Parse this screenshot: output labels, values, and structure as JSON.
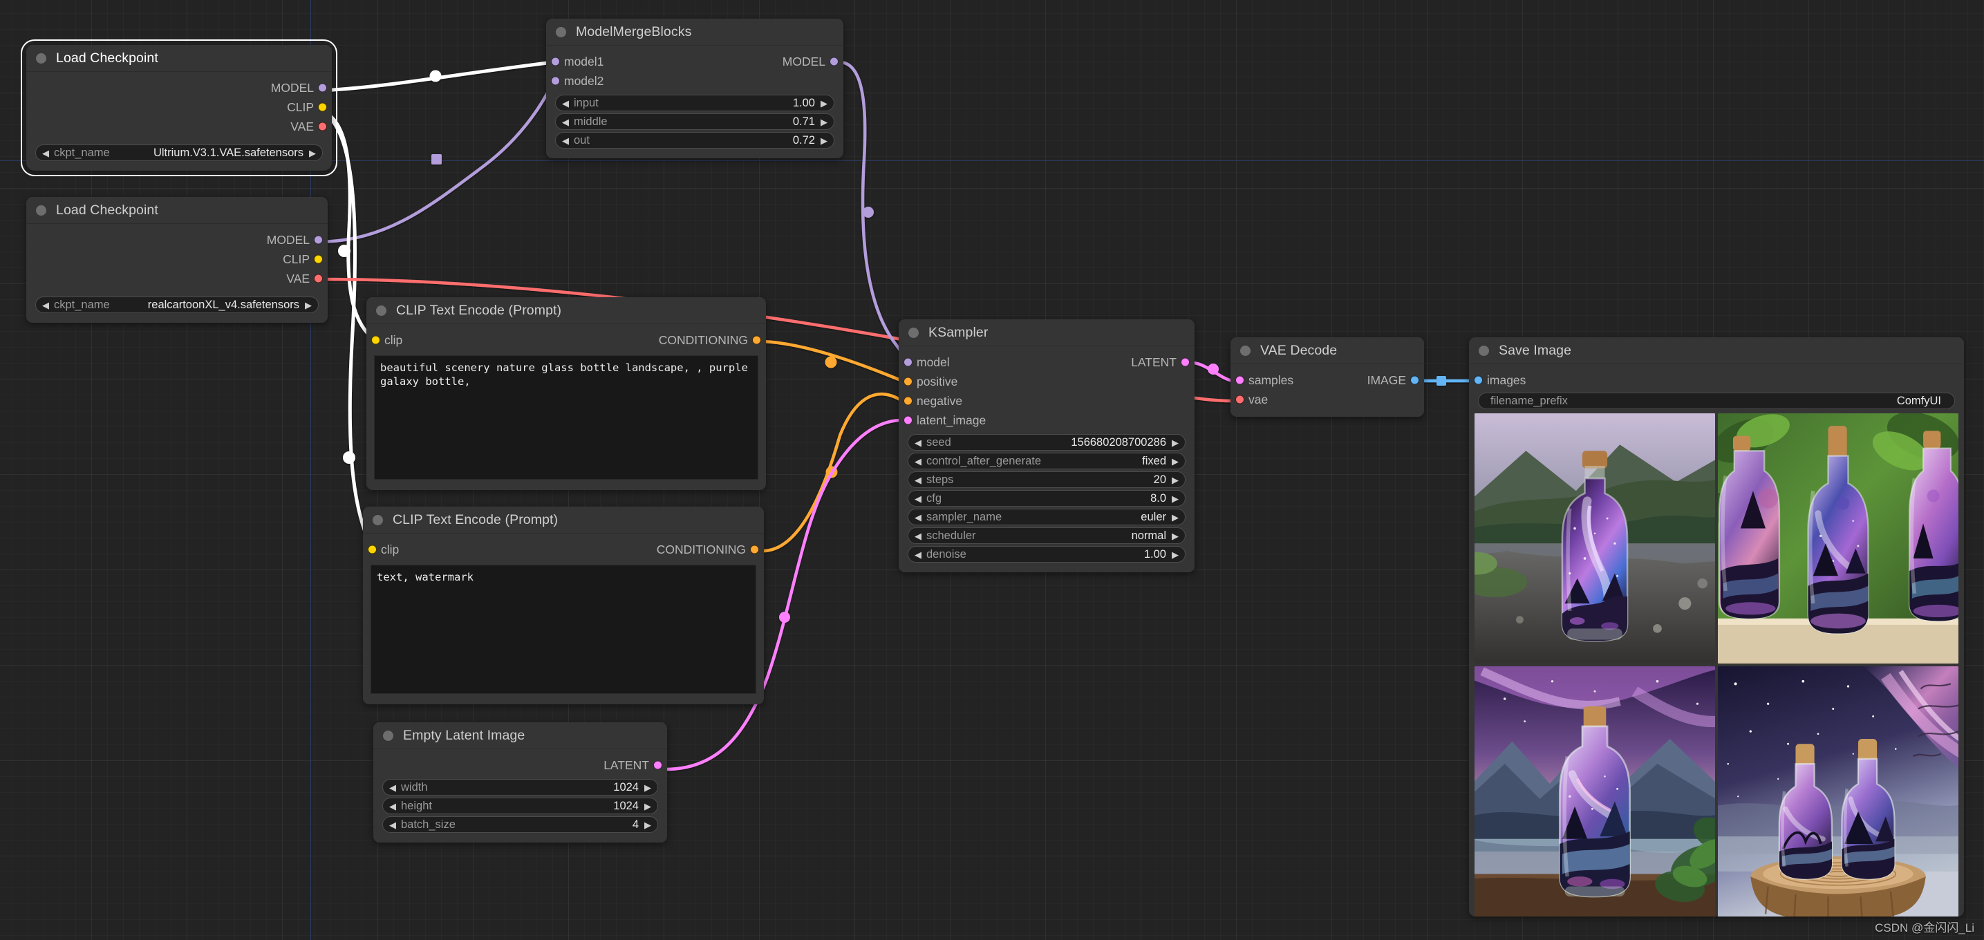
{
  "canvas": {
    "background_hex": "#232323",
    "grid_hex": "#2b2b2b",
    "axis_hex": "#2b3a63"
  },
  "link_colors": {
    "MODEL": "#B39DDB",
    "CLIP": "#FFD500",
    "VAE": "#FF6E6E",
    "CONDITIONING": "#FFA931",
    "LATENT": "#FF80FF",
    "IMAGE": "#64B5F6",
    "selected": "#FFFFFF"
  },
  "nodes": {
    "load_checkpoint_1": {
      "title": "Load Checkpoint",
      "outputs": [
        "MODEL",
        "CLIP",
        "VAE"
      ],
      "widgets": [
        {
          "name": "ckpt_name",
          "value": "Ultrium.V3.1.VAE.safetensors"
        }
      ]
    },
    "load_checkpoint_2": {
      "title": "Load Checkpoint",
      "outputs": [
        "MODEL",
        "CLIP",
        "VAE"
      ],
      "widgets": [
        {
          "name": "ckpt_name",
          "value": "realcartoonXL_v4.safetensors"
        }
      ]
    },
    "model_merge_blocks": {
      "title": "ModelMergeBlocks",
      "inputs": [
        "model1",
        "model2"
      ],
      "outputs": [
        "MODEL"
      ],
      "widgets": [
        {
          "name": "input",
          "value": "1.00"
        },
        {
          "name": "middle",
          "value": "0.71"
        },
        {
          "name": "out",
          "value": "0.72"
        }
      ]
    },
    "clip_text_encode_positive": {
      "title": "CLIP Text Encode (Prompt)",
      "inputs": [
        "clip"
      ],
      "outputs": [
        "CONDITIONING"
      ],
      "text": "beautiful scenery nature glass bottle landscape, , purple galaxy bottle,"
    },
    "clip_text_encode_negative": {
      "title": "CLIP Text Encode (Prompt)",
      "inputs": [
        "clip"
      ],
      "outputs": [
        "CONDITIONING"
      ],
      "text": "text, watermark"
    },
    "ksampler": {
      "title": "KSampler",
      "inputs": [
        "model",
        "positive",
        "negative",
        "latent_image"
      ],
      "outputs": [
        "LATENT"
      ],
      "widgets": [
        {
          "name": "seed",
          "value": "156680208700286"
        },
        {
          "name": "control_after_generate",
          "value": "fixed"
        },
        {
          "name": "steps",
          "value": "20"
        },
        {
          "name": "cfg",
          "value": "8.0"
        },
        {
          "name": "sampler_name",
          "value": "euler"
        },
        {
          "name": "scheduler",
          "value": "normal"
        },
        {
          "name": "denoise",
          "value": "1.00"
        }
      ]
    },
    "vae_decode": {
      "title": "VAE Decode",
      "inputs": [
        "samples",
        "vae"
      ],
      "outputs": [
        "IMAGE"
      ]
    },
    "save_image": {
      "title": "Save Image",
      "inputs": [
        "images"
      ],
      "widgets": [
        {
          "name": "filename_prefix",
          "value": "ComfyUI"
        }
      ],
      "images": [
        {
          "alt": "galaxy-in-bottle on riverbank with green hills"
        },
        {
          "alt": "three galaxy bottles on wooden table with foliage"
        },
        {
          "alt": "galaxy bottle before mountain lake at dusk"
        },
        {
          "alt": "two galaxy bottles on tree stump under milky way"
        }
      ]
    }
  },
  "empty_latent_image": {
    "title": "Empty Latent Image",
    "outputs": [
      "LATENT"
    ],
    "widgets": [
      {
        "name": "width",
        "value": "1024"
      },
      {
        "name": "height",
        "value": "1024"
      },
      {
        "name": "batch_size",
        "value": "4"
      }
    ]
  },
  "watermark": "CSDN @金闪闪_Li",
  "arrows": {
    "left": "◀",
    "right": "▶"
  }
}
